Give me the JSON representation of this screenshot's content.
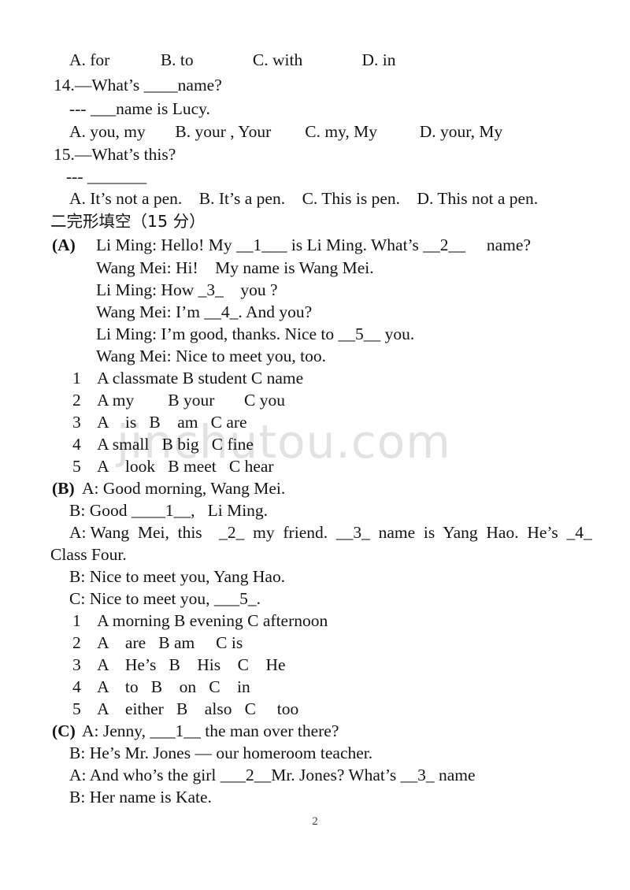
{
  "document": {
    "page_number": "2",
    "watermark": "jinchutou.com"
  },
  "section_heading": "二完形填空（15 分）",
  "multiple_choice_tail": {
    "q13_options": "A. for            B. to              C. with              D. in",
    "q14_stem": "14.—What’s ____name?",
    "q14_answer_line": "--- ___name is Lucy.",
    "q14_options": "A. you, my       B. your , Your        C. my, My          D. your, My",
    "q15_stem": "15.—What’s this?",
    "q15_answer_line": "--- _______",
    "q15_options": "A. It’s not a pen.    B. It’s a pen.    C. This is pen.    D. This not a pen."
  },
  "cloze": {
    "part_a": {
      "label": "(A)",
      "lines": [
        "Li Ming: Hello! My __1___ is Li Ming. What’s __2__     name?",
        "Wang Mei: Hi!    My name is Wang Mei.",
        "Li Ming: How _3_    you ?",
        "Wang Mei: I’m __4_. And you?",
        "Li Ming: I’m good, thanks. Nice to __5__ you.",
        "Wang Mei: Nice to meet you, too."
      ],
      "options": [
        "1    A classmate B student C name",
        "2    A my        B your       C you",
        "3    A    is   B    am   C are",
        "4    A small   B big   C fine",
        "5    A    look   B meet   C hear"
      ]
    },
    "part_b": {
      "label": "(B)",
      "first_line": "A: Good morning, Wang Mei.",
      "lines": [
        "B: Good ____1__,   Li Ming.",
        "A: Wang  Mei,  this    _2_  my  friend.  __3_  name  is  Yang  Hao.  He’s  _4_",
        "Class Four.",
        "B: Nice to meet you, Yang Hao.",
        "C: Nice to meet you, ___5_."
      ],
      "options": [
        "1    A morning B evening C afternoon",
        "2    A    are   B am     C is",
        "3    A    He’s   B    His    C    He",
        "4    A    to   B    on   C    in",
        "5    A    either   B    also   C     too"
      ]
    },
    "part_c": {
      "label": "(C)",
      "first_line": "A: Jenny, ___1__ the man over there?",
      "lines": [
        "B: He’s Mr. Jones — our homeroom teacher.",
        "A: And who’s the girl ___2__Mr. Jones? What’s __3_ name",
        "B: Her name is Kate."
      ]
    }
  }
}
